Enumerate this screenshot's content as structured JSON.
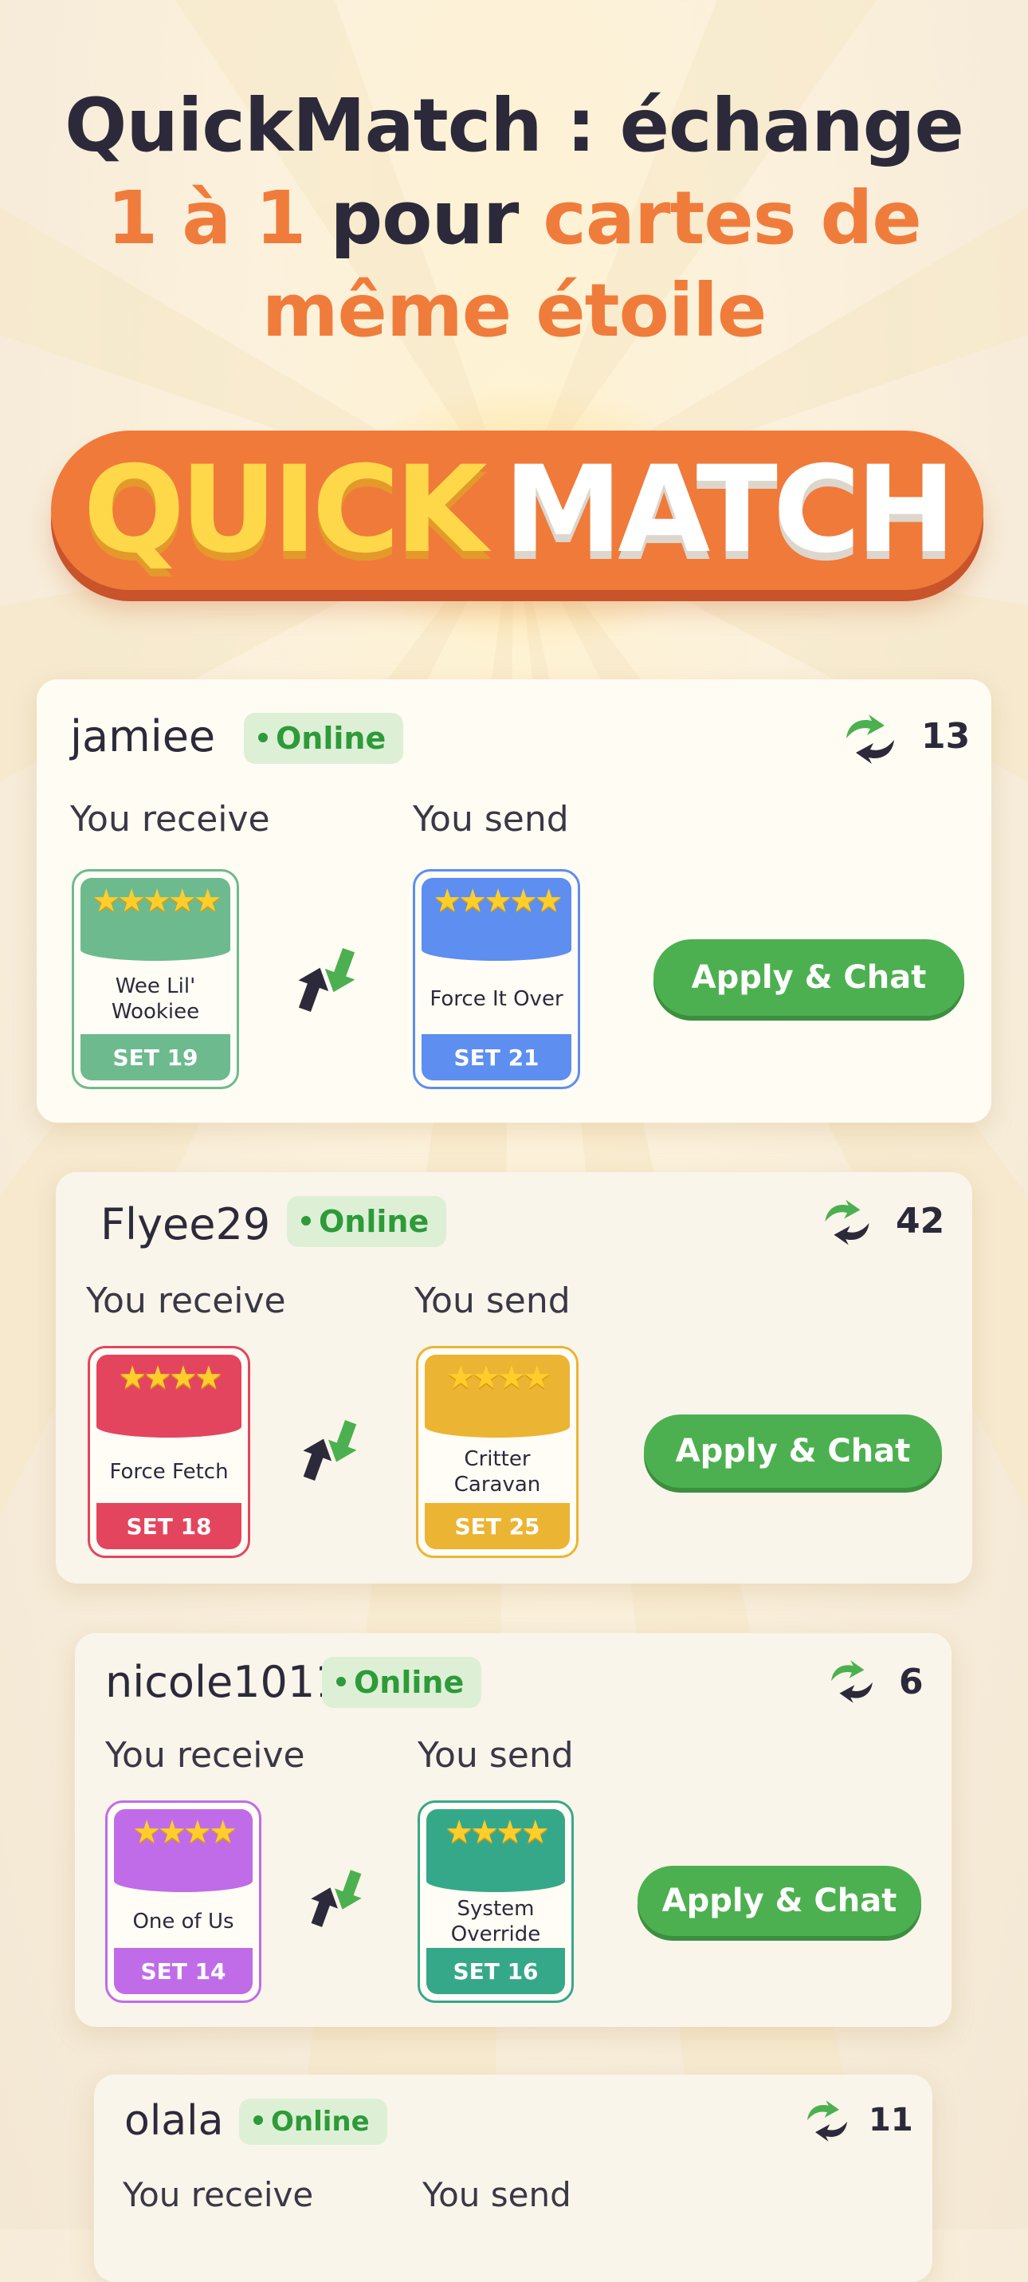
{
  "headline": {
    "line1": "QuickMatch : échange",
    "line2_accent": "1 à 1",
    "line2_plain": " pour ",
    "line2_accent2": "cartes de",
    "line3": "même étoile"
  },
  "logo": {
    "part1": "QUICK",
    "part2": "MATCH"
  },
  "colors": {
    "orange": "#f07c3c",
    "green": "#4cb050",
    "dark": "#2c2a3a",
    "card_green": "#6dba8e",
    "card_blue": "#5d8ef0",
    "card_red": "#e4455e",
    "card_yellow": "#ecb433",
    "card_purple": "#c06ce8",
    "card_teal": "#36a88a"
  },
  "labels": {
    "receive": "You receive",
    "send": "You send",
    "online": "Online",
    "apply": "Apply & Chat"
  },
  "matches": [
    {
      "user": "jamiee",
      "status": "Online",
      "trades": "13",
      "receive": {
        "name": "Wee Lil' Wookiee",
        "set": "SET 19",
        "stars": 5,
        "color": "#6dba8e"
      },
      "send": {
        "name": "Force It Over",
        "set": "SET 21",
        "stars": 5,
        "color": "#5d8ef0"
      },
      "action": "Apply & Chat"
    },
    {
      "user": "Flyee29",
      "status": "Online",
      "trades": "42",
      "receive": {
        "name": "Force Fetch",
        "set": "SET 18",
        "stars": 4,
        "color": "#e4455e"
      },
      "send": {
        "name": "Critter Caravan",
        "set": "SET 25",
        "stars": 4,
        "color": "#ecb433"
      },
      "action": "Apply & Chat"
    },
    {
      "user": "nicole1011",
      "status": "Online",
      "trades": "6",
      "receive": {
        "name": "One of Us",
        "set": "SET 14",
        "stars": 4,
        "color": "#c06ce8"
      },
      "send": {
        "name": "System Override",
        "set": "SET 16",
        "stars": 4,
        "color": "#36a88a"
      },
      "action": "Apply & Chat"
    },
    {
      "user": "olala",
      "status": "Online",
      "trades": "11"
    }
  ]
}
